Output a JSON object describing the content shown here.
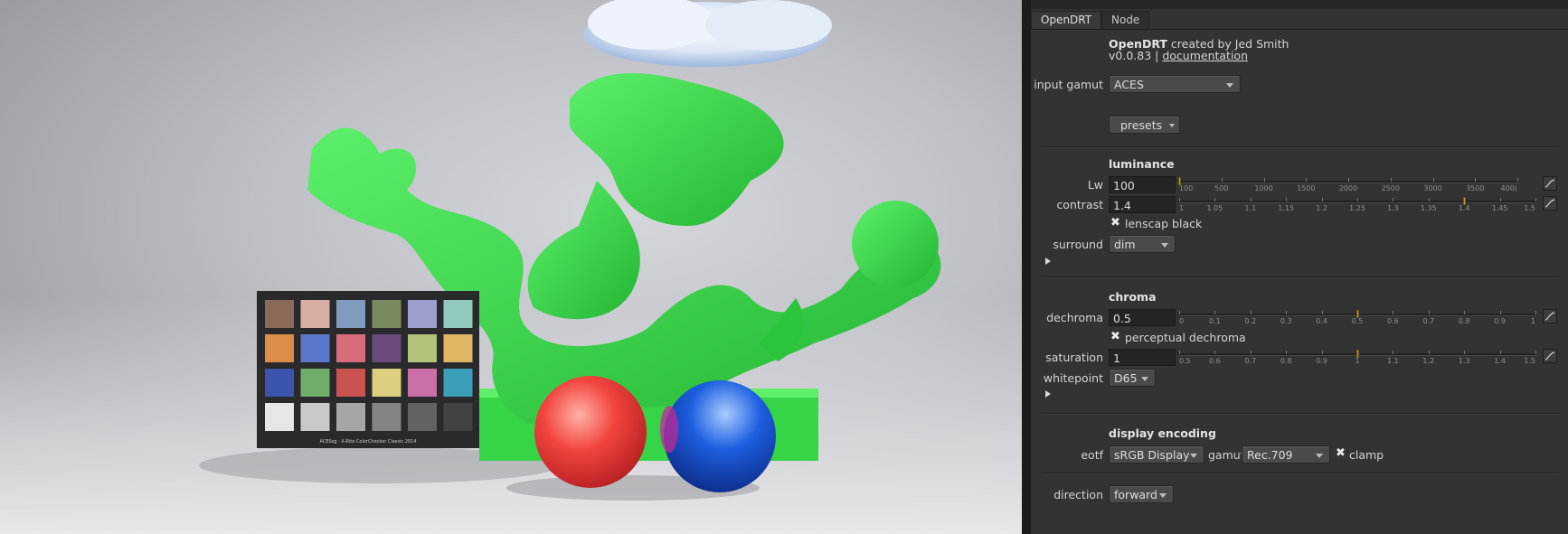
{
  "tabs": [
    "OpenDRT",
    "Node"
  ],
  "header": {
    "title": "OpenDRT",
    "byline": " created by Jed Smith",
    "version": "v0.0.83 | ",
    "doc_link": "documentation"
  },
  "input_gamut": {
    "label": "input gamut",
    "value": "ACES"
  },
  "presets": {
    "label": "presets"
  },
  "luminance": {
    "heading": "luminance",
    "lw": {
      "label": "Lw",
      "value": "100",
      "ticks": [
        "100",
        "500",
        "1000",
        "1500",
        "2000",
        "2500",
        "3000",
        "3500",
        "400("
      ],
      "handle_fraction": 0.0
    },
    "contrast": {
      "label": "contrast",
      "value": "1.4",
      "ticks": [
        "1",
        "1.05",
        "1.1",
        "1.15",
        "1.2",
        "1.25",
        "1.3",
        "1.35",
        "1.4",
        "1.45",
        "1.5"
      ],
      "handle_fraction": 0.8
    },
    "lenscap": {
      "label": "lenscap black",
      "checked": true
    },
    "surround": {
      "label": "surround",
      "value": "dim"
    }
  },
  "chroma": {
    "heading": "chroma",
    "dechroma": {
      "label": "dechroma",
      "value": "0.5",
      "ticks": [
        "0",
        "0.1",
        "0.2",
        "0.3",
        "0.4",
        "0.5",
        "0.6",
        "0.7",
        "0.8",
        "0.9",
        "1"
      ],
      "handle_fraction": 0.5
    },
    "perceptual": {
      "label": "perceptual dechroma",
      "checked": true
    },
    "saturation": {
      "label": "saturation",
      "value": "1",
      "ticks": [
        "0.5",
        "0.6",
        "0.7",
        "0.8",
        "0.9",
        "1",
        "1.1",
        "1.2",
        "1.3",
        "1.4",
        "1.5"
      ],
      "handle_fraction": 0.5
    },
    "whitepoint": {
      "label": "whitepoint",
      "value": "D65"
    }
  },
  "display": {
    "heading": "display encoding",
    "eotf": {
      "label": "eotf",
      "value": "sRGB Display"
    },
    "gamut": {
      "label": "gamut",
      "value": "Rec.709"
    },
    "clamp": {
      "label": "clamp",
      "checked": true
    }
  },
  "direction": {
    "label": "direction",
    "value": "forward"
  },
  "colors": {
    "panel": "#333333",
    "field": "#242424",
    "handle": "#c39a3a",
    "dragon": "#3ee04a",
    "red_ball": "#f2453f",
    "blue_ball": "#1c5fe0"
  },
  "viewer": {
    "checker_caption": "ACESsg - X-Rite ColorChecker Classic 2014",
    "checker_colors": [
      "#8b6a5a",
      "#d9aea2",
      "#7f9bbd",
      "#798a5f",
      "#9e9fcf",
      "#90c9be",
      "#dd8d4a",
      "#5a78c9",
      "#d86c7b",
      "#6b4a7c",
      "#b1c27a",
      "#deb664",
      "#3b55ad",
      "#6fae6a",
      "#c9534f",
      "#dcd07e",
      "#cb6fa9",
      "#3c9fb8",
      "#e6e6e6",
      "#c9c9c9",
      "#a6a6a6",
      "#848484",
      "#626262",
      "#434343"
    ]
  }
}
